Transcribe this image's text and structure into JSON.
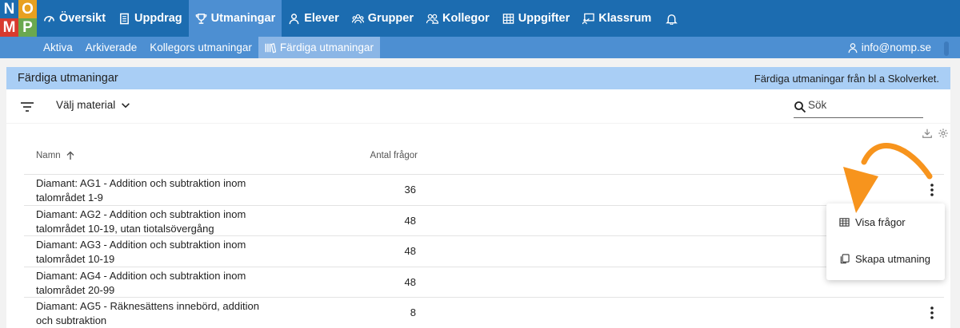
{
  "logo": {
    "letters": [
      "N",
      "O",
      "M",
      "P"
    ],
    "colors": [
      "#1c6cb0",
      "#e8a020",
      "#d83a2e",
      "#6aa84f"
    ]
  },
  "nav": {
    "items": [
      {
        "label": "Översikt",
        "icon": "dashboard-icon"
      },
      {
        "label": "Uppdrag",
        "icon": "document-icon"
      },
      {
        "label": "Utmaningar",
        "icon": "trophy-icon",
        "active": true
      },
      {
        "label": "Elever",
        "icon": "person-icon"
      },
      {
        "label": "Grupper",
        "icon": "group-icon"
      },
      {
        "label": "Kollegor",
        "icon": "colleagues-icon"
      },
      {
        "label": "Uppgifter",
        "icon": "grid-icon"
      },
      {
        "label": "Klassrum",
        "icon": "classroom-icon"
      }
    ],
    "bell_icon": "bell-icon"
  },
  "subnav": {
    "items": [
      {
        "label": "Aktiva"
      },
      {
        "label": "Arkiverade"
      },
      {
        "label": "Kollegors utmaningar"
      },
      {
        "label": "Färdiga utmaningar",
        "active": true,
        "icon": "library-icon"
      }
    ],
    "account": "info@nomp.se"
  },
  "page": {
    "title": "Färdiga utmaningar",
    "description": "Färdiga utmaningar från bl a Skolverket."
  },
  "toolbar": {
    "material_label": "Välj material",
    "search_placeholder": "Sök"
  },
  "table": {
    "columns": {
      "name": "Namn",
      "count": "Antal frågor"
    },
    "rows": [
      {
        "name": "Diamant: AG1 - Addition och subtraktion inom talområdet 1-9",
        "count": "36"
      },
      {
        "name": "Diamant: AG2 - Addition och subtraktion inom talområdet 10-19, utan tiotalsövergång",
        "count": "48"
      },
      {
        "name": "Diamant: AG3 - Addition och subtraktion inom talområdet 10-19",
        "count": "48"
      },
      {
        "name": "Diamant: AG4 - Addition och subtraktion inom talområdet 20-99",
        "count": "48"
      },
      {
        "name": "Diamant: AG5 - Räknesättens innebörd, addition och subtraktion",
        "count": "8"
      }
    ]
  },
  "menu": {
    "items": [
      {
        "label": "Visa frågor",
        "icon": "table-icon"
      },
      {
        "label": "Skapa utmaning",
        "icon": "copy-icon"
      }
    ]
  },
  "colors": {
    "primary": "#1c6cb0",
    "secondary": "#4d8fd2",
    "band": "#a9cef5",
    "arrow": "#f7941d"
  }
}
